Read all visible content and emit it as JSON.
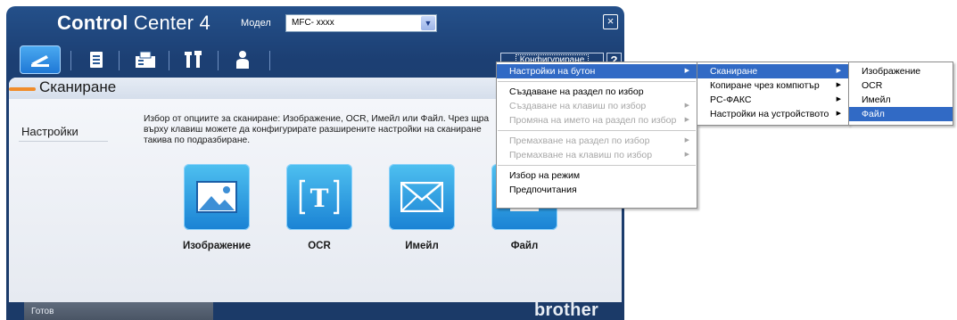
{
  "window": {
    "title_bold": "Control",
    "title_rest": " Center 4",
    "model_label": "Модел",
    "model_value": "MFC- xxxx",
    "close_glyph": "×"
  },
  "toolbar": {
    "tabs": [
      {
        "icon": "scan-icon",
        "active": true
      },
      {
        "icon": "document-icon"
      },
      {
        "icon": "fax-icon"
      },
      {
        "icon": "tools-icon"
      },
      {
        "icon": "person-icon"
      }
    ],
    "config_label": "Конфигуриране",
    "help_label": "?"
  },
  "section": {
    "title": "Сканиране",
    "settings_label": "Настройки",
    "description": "Избор от опциите за сканиране: Изображение, OCR, Имейл или Файл. Чрез щра въpху клавиш можете да конфигурирате  разширените настройки на сканиране такива по подразбиране."
  },
  "functions": [
    {
      "label": "Изображение",
      "icon": "image-icon"
    },
    {
      "label": "OCR",
      "icon": "ocr-icon"
    },
    {
      "label": "Имейл",
      "icon": "email-icon"
    },
    {
      "label": "Файл",
      "icon": "file-icon"
    }
  ],
  "status": {
    "text": "Готов",
    "brand": "brother"
  },
  "menus": {
    "main": [
      {
        "label": "Настройки на бутон",
        "submenu": true,
        "highlighted": true
      },
      {
        "separator": true
      },
      {
        "label": "Създаване на раздел по избор"
      },
      {
        "label": "Създаване на клавиш по избор",
        "submenu": true,
        "disabled": true
      },
      {
        "label": "Промяна на името на раздел по избор",
        "submenu": true,
        "disabled": true
      },
      {
        "separator": true
      },
      {
        "label": "Премахване на раздел по избор",
        "submenu": true,
        "disabled": true
      },
      {
        "label": "Премахване на клавиш по избор",
        "submenu": true,
        "disabled": true
      },
      {
        "separator": true
      },
      {
        "label": "Избор на режим"
      },
      {
        "label": "Предпочитания"
      }
    ],
    "buttons": [
      {
        "label": "Сканиране",
        "submenu": true,
        "highlighted": true
      },
      {
        "label": "Копиране чрез компютър",
        "submenu": true
      },
      {
        "label": "PC-ФАКС",
        "submenu": true
      },
      {
        "label": "Настройки на устройството",
        "submenu": true
      }
    ],
    "scan": [
      {
        "label": "Изображение"
      },
      {
        "label": "OCR"
      },
      {
        "label": "Имейл"
      },
      {
        "label": "Файл",
        "highlighted": true
      }
    ]
  },
  "colors": {
    "window_blue": "#1c3f73",
    "accent_orange": "#f08c2a",
    "menu_highlight": "#316ac5",
    "tile_blue": "#1a82d4"
  }
}
